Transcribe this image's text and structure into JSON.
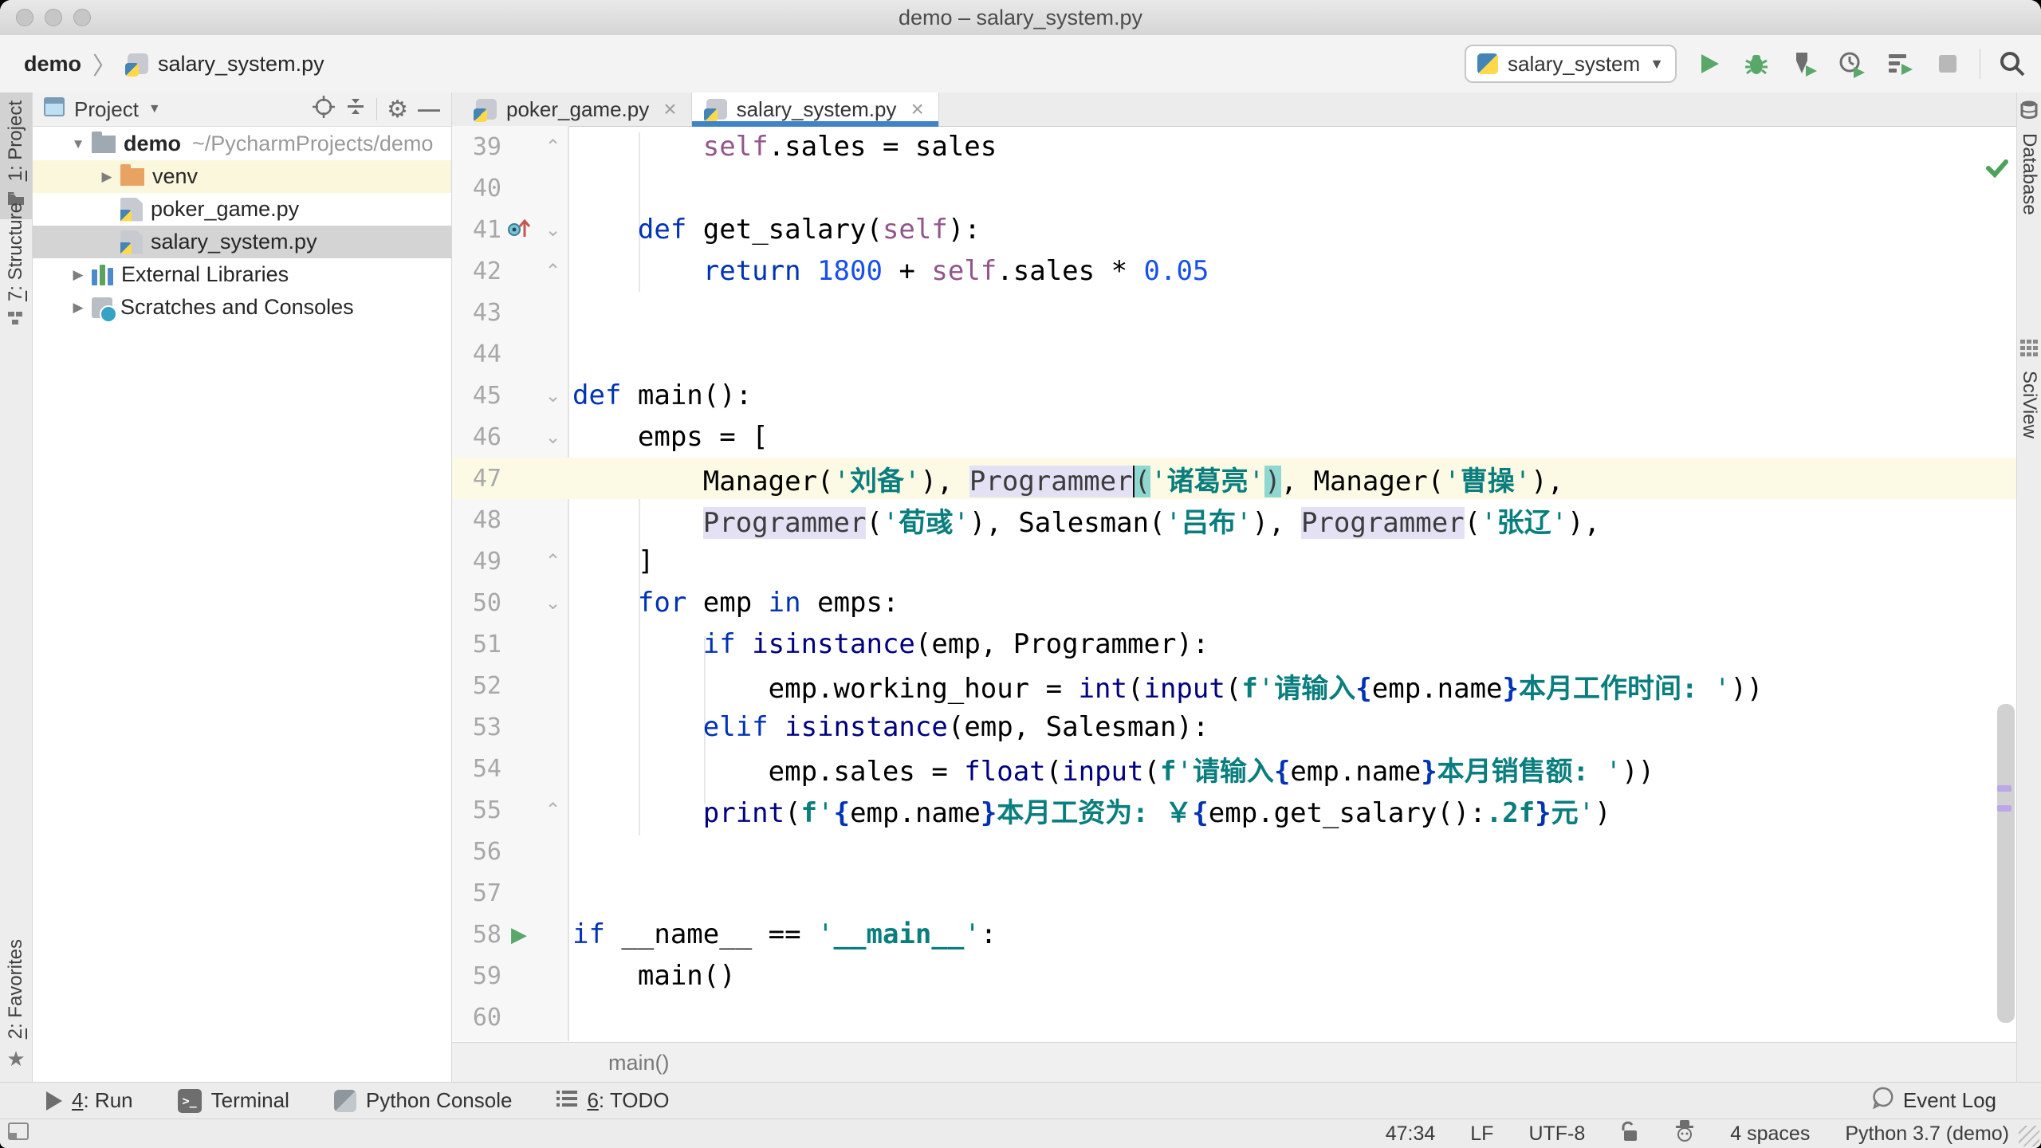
{
  "window": {
    "title": "demo – salary_system.py"
  },
  "navbar": {
    "breadcrumb_project": "demo",
    "breadcrumb_file": "salary_system.py",
    "run_config": "salary_system",
    "icons": [
      "python-icon",
      "run-icon",
      "debug-icon",
      "coverage-icon",
      "profile-icon",
      "concurrency-icon",
      "stop-icon",
      "search-icon"
    ]
  },
  "left_stripe": {
    "items": [
      {
        "label": "1: Project",
        "icon": "project-folder-icon",
        "active": true
      },
      {
        "label": "7: Structure",
        "icon": "structure-icon",
        "active": false
      },
      {
        "label": "2: Favorites",
        "icon": "star-icon",
        "active": false
      }
    ]
  },
  "right_stripe": {
    "items": [
      {
        "label": "Database",
        "icon": "database-icon"
      },
      {
        "label": "SciView",
        "icon": "grid-icon"
      }
    ]
  },
  "project_panel": {
    "title": "Project",
    "header_icons": [
      "window-icon",
      "locate-icon",
      "collapse-all-icon",
      "gear-icon",
      "hide-icon"
    ],
    "tree": [
      {
        "icon": "folder-gray",
        "arrow": "down",
        "label": "demo",
        "bold": true,
        "path": "~/PycharmProjects/demo",
        "bg": ""
      },
      {
        "icon": "folder-orange",
        "arrow": "right",
        "label": "venv",
        "bold": false,
        "path": "",
        "bg": "mark",
        "indent": 1
      },
      {
        "icon": "pyfile",
        "arrow": "",
        "label": "poker_game.py",
        "bold": false,
        "path": "",
        "bg": "",
        "indent": 1
      },
      {
        "icon": "pyfile",
        "arrow": "",
        "label": "salary_system.py",
        "bold": false,
        "path": "",
        "bg": "sel",
        "indent": 1
      },
      {
        "icon": "libs",
        "arrow": "right",
        "label": "External Libraries",
        "bold": false,
        "path": "",
        "bg": "",
        "indent": 0
      },
      {
        "icon": "scratch",
        "arrow": "right",
        "label": "Scratches and Consoles",
        "bold": false,
        "path": "",
        "bg": "",
        "indent": 0
      }
    ]
  },
  "tabs": [
    {
      "label": "poker_game.py",
      "close": "×",
      "active": false
    },
    {
      "label": "salary_system.py",
      "close": "×",
      "active": true
    }
  ],
  "editor": {
    "breadcrumb": "main()",
    "lines": [
      {
        "n": 39,
        "fold": "up",
        "segs": [
          [
            "sp",
            "        "
          ],
          [
            "self",
            "self"
          ],
          [
            "sp",
            ".sales = sales"
          ]
        ]
      },
      {
        "n": 40,
        "segs": []
      },
      {
        "n": 41,
        "fold": "down",
        "icon": "override",
        "segs": [
          [
            "sp",
            "    "
          ],
          [
            "kw",
            "def"
          ],
          [
            "sp",
            " get_salary("
          ],
          [
            "self",
            "self"
          ],
          [
            "sp",
            "):"
          ]
        ]
      },
      {
        "n": 42,
        "fold": "up",
        "segs": [
          [
            "sp",
            "        "
          ],
          [
            "kw",
            "return"
          ],
          [
            "sp",
            " "
          ],
          [
            "num",
            "1800"
          ],
          [
            "sp",
            " + "
          ],
          [
            "self",
            "self"
          ],
          [
            "sp",
            ".sales * "
          ],
          [
            "num",
            "0.05"
          ]
        ]
      },
      {
        "n": 43,
        "segs": []
      },
      {
        "n": 44,
        "segs": []
      },
      {
        "n": 45,
        "fold": "down",
        "segs": [
          [
            "kw",
            "def"
          ],
          [
            "sp",
            " main():"
          ]
        ]
      },
      {
        "n": 46,
        "fold": "down",
        "segs": [
          [
            "sp",
            "    emps = ["
          ]
        ]
      },
      {
        "n": 47,
        "current": true,
        "segs": [
          [
            "sp",
            "        Manager("
          ],
          [
            "str",
            "'"
          ],
          [
            "strb",
            "刘备"
          ],
          [
            "str",
            "'"
          ],
          [
            "sp",
            "), "
          ],
          [
            "hlid",
            "Programmer"
          ],
          [
            "caret",
            ""
          ],
          [
            "hlp",
            "("
          ],
          [
            "str",
            "'"
          ],
          [
            "strb",
            "诸葛亮"
          ],
          [
            "str",
            "'"
          ],
          [
            "hlp",
            ")"
          ],
          [
            "sp",
            ", Manager("
          ],
          [
            "str",
            "'"
          ],
          [
            "strb",
            "曹操"
          ],
          [
            "str",
            "'"
          ],
          [
            "sp",
            "),"
          ]
        ]
      },
      {
        "n": 48,
        "segs": [
          [
            "sp",
            "        "
          ],
          [
            "hlid",
            "Programmer"
          ],
          [
            "sp",
            "("
          ],
          [
            "str",
            "'"
          ],
          [
            "strb",
            "荀彧"
          ],
          [
            "str",
            "'"
          ],
          [
            "sp",
            "), Salesman("
          ],
          [
            "str",
            "'"
          ],
          [
            "strb",
            "吕布"
          ],
          [
            "str",
            "'"
          ],
          [
            "sp",
            "), "
          ],
          [
            "hlid",
            "Programmer"
          ],
          [
            "sp",
            "("
          ],
          [
            "str",
            "'"
          ],
          [
            "strb",
            "张辽"
          ],
          [
            "str",
            "'"
          ],
          [
            "sp",
            "),"
          ]
        ]
      },
      {
        "n": 49,
        "fold": "up",
        "segs": [
          [
            "sp",
            "    ]"
          ]
        ]
      },
      {
        "n": 50,
        "fold": "down",
        "segs": [
          [
            "sp",
            "    "
          ],
          [
            "kw",
            "for"
          ],
          [
            "sp",
            " emp "
          ],
          [
            "kw",
            "in"
          ],
          [
            "sp",
            " emps:"
          ]
        ]
      },
      {
        "n": 51,
        "segs": [
          [
            "sp",
            "        "
          ],
          [
            "kw",
            "if"
          ],
          [
            "sp",
            " "
          ],
          [
            "bi",
            "isinstance"
          ],
          [
            "sp",
            "(emp, Programmer):"
          ]
        ]
      },
      {
        "n": 52,
        "segs": [
          [
            "sp",
            "            emp.working_hour = "
          ],
          [
            "bi",
            "int"
          ],
          [
            "sp",
            "("
          ],
          [
            "bi",
            "input"
          ],
          [
            "sp",
            "("
          ],
          [
            "fpre",
            "f"
          ],
          [
            "str",
            "'"
          ],
          [
            "strb",
            "请输入"
          ],
          [
            "brc",
            "{"
          ],
          [
            "sp",
            "emp.name"
          ],
          [
            "brc",
            "}"
          ],
          [
            "strb",
            "本月工作时间: "
          ],
          [
            "str",
            "'"
          ],
          [
            "sp",
            "))"
          ]
        ]
      },
      {
        "n": 53,
        "segs": [
          [
            "sp",
            "        "
          ],
          [
            "kw",
            "elif"
          ],
          [
            "sp",
            " "
          ],
          [
            "bi",
            "isinstance"
          ],
          [
            "sp",
            "(emp, Salesman):"
          ]
        ]
      },
      {
        "n": 54,
        "segs": [
          [
            "sp",
            "            emp.sales = "
          ],
          [
            "bi",
            "float"
          ],
          [
            "sp",
            "("
          ],
          [
            "bi",
            "input"
          ],
          [
            "sp",
            "("
          ],
          [
            "fpre",
            "f"
          ],
          [
            "str",
            "'"
          ],
          [
            "strb",
            "请输入"
          ],
          [
            "brc",
            "{"
          ],
          [
            "sp",
            "emp.name"
          ],
          [
            "brc",
            "}"
          ],
          [
            "strb",
            "本月销售额: "
          ],
          [
            "str",
            "'"
          ],
          [
            "sp",
            "))"
          ]
        ]
      },
      {
        "n": 55,
        "fold": "up",
        "segs": [
          [
            "sp",
            "        "
          ],
          [
            "bi",
            "print"
          ],
          [
            "sp",
            "("
          ],
          [
            "fpre",
            "f"
          ],
          [
            "str",
            "'"
          ],
          [
            "brc",
            "{"
          ],
          [
            "sp",
            "emp.name"
          ],
          [
            "brc",
            "}"
          ],
          [
            "strb",
            "本月工资为: ￥"
          ],
          [
            "brc",
            "{"
          ],
          [
            "sp",
            "emp.get_salary():"
          ],
          [
            "strb",
            ".2f"
          ],
          [
            "brc",
            "}"
          ],
          [
            "strb",
            "元"
          ],
          [
            "str",
            "'"
          ],
          [
            "sp",
            ")"
          ]
        ]
      },
      {
        "n": 56,
        "segs": []
      },
      {
        "n": 57,
        "segs": []
      },
      {
        "n": 58,
        "icon": "run",
        "segs": [
          [
            "kw",
            "if"
          ],
          [
            "sp",
            " __name__ == "
          ],
          [
            "str",
            "'"
          ],
          [
            "strb",
            "__main__"
          ],
          [
            "str",
            "'"
          ],
          [
            "sp",
            ":"
          ]
        ]
      },
      {
        "n": 59,
        "segs": [
          [
            "sp",
            "    main()"
          ]
        ]
      },
      {
        "n": 60,
        "segs": []
      }
    ]
  },
  "bottom_bar": {
    "items": [
      {
        "label": "4: Run",
        "icon": "run-toolwindow-icon"
      },
      {
        "label": "Terminal",
        "icon": "terminal-icon"
      },
      {
        "label": "Python Console",
        "icon": "python-console-icon"
      },
      {
        "label": "6: TODO",
        "icon": "todo-list-icon"
      }
    ],
    "event_log": "Event Log"
  },
  "status_bar": {
    "caret_pos": "47:34",
    "line_separator": "LF",
    "encoding": "UTF-8",
    "icons": [
      "unlock-icon",
      "hector-icon"
    ],
    "indent": "4 spaces",
    "interpreter": "Python 3.7 (demo)"
  },
  "colors": {
    "accent_tab_underline": "#4083C9",
    "run_green": "#59A869",
    "current_line": "#FCF9E4",
    "usage_highlight": "#E4E1F4",
    "matched_paren": "#8FD8D2",
    "tree_selection": "#D4D4D4",
    "tree_mark": "#FBF7DC"
  }
}
